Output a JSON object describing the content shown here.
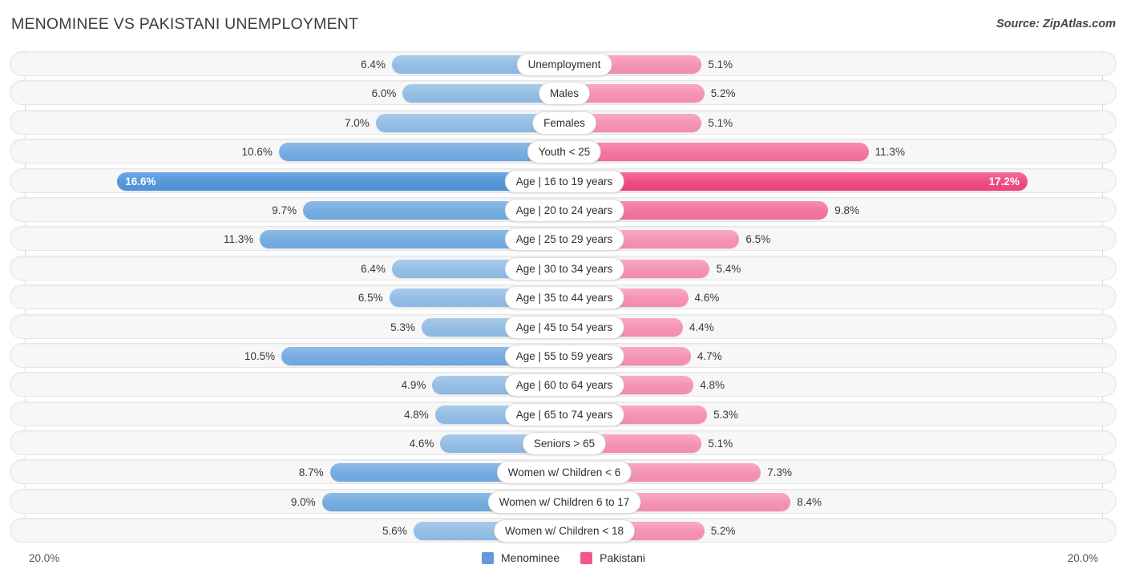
{
  "header": {
    "title": "MENOMINEE VS PAKISTANI UNEMPLOYMENT",
    "source": "Source: ZipAtlas.com"
  },
  "axis": {
    "left_label": "20.0%",
    "right_label": "20.0%",
    "max": 20.0
  },
  "legend": {
    "items": [
      {
        "label": "Menominee",
        "color": "#6699dd"
      },
      {
        "label": "Pakistani",
        "color": "#f2558f"
      }
    ]
  },
  "colors": {
    "left_light": "#94bde4",
    "left_mid": "#76ace0",
    "left_high": "#5596da",
    "right_light": "#f493b4",
    "right_mid": "#f375a0",
    "right_high": "#ef4b85",
    "track": "#f7f7f7",
    "gridline": "#d8d8d8"
  },
  "chart_data": {
    "type": "bar",
    "orientation": "horizontal-diverging",
    "title": "MENOMINEE VS PAKISTANI UNEMPLOYMENT",
    "xlabel": "",
    "ylabel": "",
    "xlim": [
      20.0,
      20.0
    ],
    "grid": true,
    "legend_position": "bottom-center",
    "categories": [
      "Unemployment",
      "Males",
      "Females",
      "Youth < 25",
      "Age | 16 to 19 years",
      "Age | 20 to 24 years",
      "Age | 25 to 29 years",
      "Age | 30 to 34 years",
      "Age | 35 to 44 years",
      "Age | 45 to 54 years",
      "Age | 55 to 59 years",
      "Age | 60 to 64 years",
      "Age | 65 to 74 years",
      "Seniors > 65",
      "Women w/ Children < 6",
      "Women w/ Children 6 to 17",
      "Women w/ Children < 18"
    ],
    "series": [
      {
        "name": "Menominee",
        "values": [
          6.4,
          6.0,
          7.0,
          10.6,
          16.6,
          9.7,
          11.3,
          6.4,
          6.5,
          5.3,
          10.5,
          4.9,
          4.8,
          4.6,
          8.7,
          9.0,
          5.6
        ]
      },
      {
        "name": "Pakistani",
        "values": [
          5.1,
          5.2,
          5.1,
          11.3,
          17.2,
          9.8,
          6.5,
          5.4,
          4.6,
          4.4,
          4.7,
          4.8,
          5.3,
          5.1,
          7.3,
          8.4,
          5.2
        ]
      }
    ]
  },
  "rows": [
    {
      "label": "Unemployment",
      "left": "6.4%",
      "right": "5.1%",
      "left_v": 6.4,
      "right_v": 5.1,
      "emphasis": "none"
    },
    {
      "label": "Males",
      "left": "6.0%",
      "right": "5.2%",
      "left_v": 6.0,
      "right_v": 5.2,
      "emphasis": "none"
    },
    {
      "label": "Females",
      "left": "7.0%",
      "right": "5.1%",
      "left_v": 7.0,
      "right_v": 5.1,
      "emphasis": "none"
    },
    {
      "label": "Youth < 25",
      "left": "10.6%",
      "right": "11.3%",
      "left_v": 10.6,
      "right_v": 11.3,
      "emphasis": "mid"
    },
    {
      "label": "Age | 16 to 19 years",
      "left": "16.6%",
      "right": "17.2%",
      "left_v": 16.6,
      "right_v": 17.2,
      "emphasis": "hi"
    },
    {
      "label": "Age | 20 to 24 years",
      "left": "9.7%",
      "right": "9.8%",
      "left_v": 9.7,
      "right_v": 9.8,
      "emphasis": "mid"
    },
    {
      "label": "Age | 25 to 29 years",
      "left": "11.3%",
      "right": "6.5%",
      "left_v": 11.3,
      "right_v": 6.5,
      "emphasis": "mid-left"
    },
    {
      "label": "Age | 30 to 34 years",
      "left": "6.4%",
      "right": "5.4%",
      "left_v": 6.4,
      "right_v": 5.4,
      "emphasis": "none"
    },
    {
      "label": "Age | 35 to 44 years",
      "left": "6.5%",
      "right": "4.6%",
      "left_v": 6.5,
      "right_v": 4.6,
      "emphasis": "none"
    },
    {
      "label": "Age | 45 to 54 years",
      "left": "5.3%",
      "right": "4.4%",
      "left_v": 5.3,
      "right_v": 4.4,
      "emphasis": "none"
    },
    {
      "label": "Age | 55 to 59 years",
      "left": "10.5%",
      "right": "4.7%",
      "left_v": 10.5,
      "right_v": 4.7,
      "emphasis": "mid-left"
    },
    {
      "label": "Age | 60 to 64 years",
      "left": "4.9%",
      "right": "4.8%",
      "left_v": 4.9,
      "right_v": 4.8,
      "emphasis": "none"
    },
    {
      "label": "Age | 65 to 74 years",
      "left": "4.8%",
      "right": "5.3%",
      "left_v": 4.8,
      "right_v": 5.3,
      "emphasis": "none"
    },
    {
      "label": "Seniors > 65",
      "left": "4.6%",
      "right": "5.1%",
      "left_v": 4.6,
      "right_v": 5.1,
      "emphasis": "none"
    },
    {
      "label": "Women w/ Children < 6",
      "left": "8.7%",
      "right": "7.3%",
      "left_v": 8.7,
      "right_v": 7.3,
      "emphasis": "mid-left"
    },
    {
      "label": "Women w/ Children 6 to 17",
      "left": "9.0%",
      "right": "8.4%",
      "left_v": 9.0,
      "right_v": 8.4,
      "emphasis": "mid-left"
    },
    {
      "label": "Women w/ Children < 18",
      "left": "5.6%",
      "right": "5.2%",
      "left_v": 5.6,
      "right_v": 5.2,
      "emphasis": "none"
    }
  ]
}
